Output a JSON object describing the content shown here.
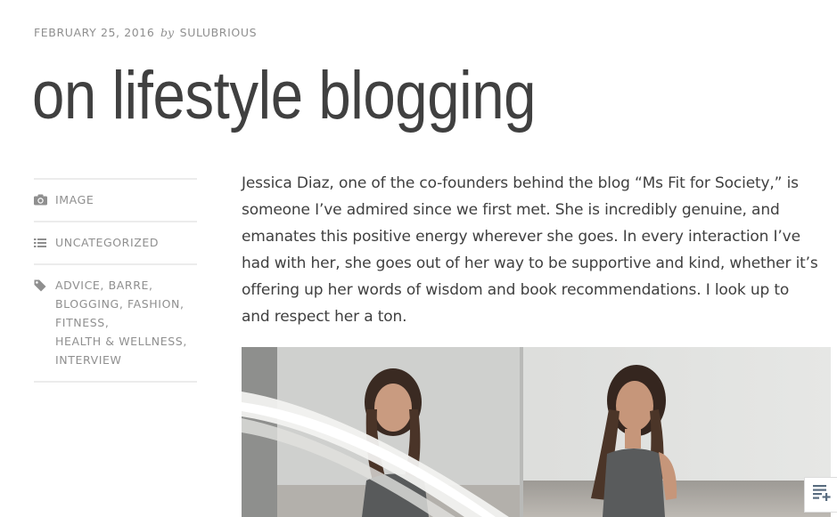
{
  "post": {
    "date": "FEBRUARY 25, 2016",
    "by_word": "by",
    "author": "SULUBRIOUS",
    "title": "on lifestyle blogging"
  },
  "sidebar": {
    "format": {
      "icon": "camera-icon",
      "label": "IMAGE"
    },
    "category": {
      "icon": "list-icon",
      "label": "UNCATEGORIZED"
    },
    "tags": {
      "icon": "tag-icon",
      "items": [
        "ADVICE",
        "BARRE",
        "BLOGGING",
        "FASHION",
        "FITNESS",
        "HEALTH & WELLNESS",
        "INTERVIEW"
      ]
    }
  },
  "content": {
    "paragraph": "Jessica Diaz, one of the co-founders behind the blog “Ms Fit for Society,” is someone I’ve admired since we first met. She is incredibly genuine, and emanates this positive energy wherever she goes. In every interaction I’ve had with her, she goes out of her way to be supportive and kind, whether it’s offering up her words of wisdom and book recommendations. I look up to and respect her a ton."
  },
  "widget": {
    "icon": "follow-reader-icon"
  },
  "colors": {
    "text": "#404040",
    "meta": "#8f8f8f",
    "divider": "#ececec"
  }
}
